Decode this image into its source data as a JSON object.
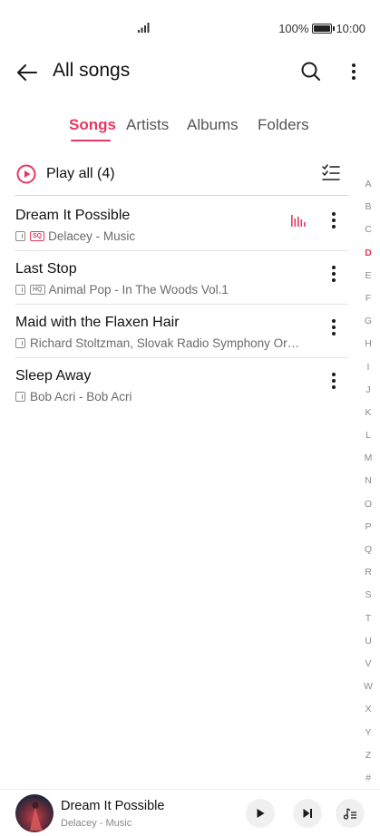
{
  "status_bar": {
    "battery": "100%",
    "time": "10:00",
    "battery_level": 1.0
  },
  "header": {
    "title": "All songs"
  },
  "tabs": [
    {
      "label": "Songs",
      "active": true
    },
    {
      "label": "Artists",
      "active": false
    },
    {
      "label": "Albums",
      "active": false
    },
    {
      "label": "Folders",
      "active": false
    }
  ],
  "play_all": {
    "label": "Play all (4)"
  },
  "songs": [
    {
      "title": "Dream It Possible",
      "subtitle": "Delacey - Music",
      "badge": "SQ",
      "playing": true
    },
    {
      "title": "Last Stop",
      "subtitle": "Animal Pop - In The Woods Vol.1",
      "badge": "HQ",
      "playing": false
    },
    {
      "title": "Maid with the Flaxen Hair",
      "subtitle": "Richard Stoltzman, Slovak Radio Symphony Orc…",
      "badge": "",
      "playing": false
    },
    {
      "title": "Sleep Away",
      "subtitle": "Bob Acri - Bob Acri",
      "badge": "",
      "playing": false
    }
  ],
  "alphabet_index": [
    "A",
    "B",
    "C",
    "D",
    "E",
    "F",
    "G",
    "H",
    "I",
    "J",
    "K",
    "L",
    "M",
    "N",
    "O",
    "P",
    "Q",
    "R",
    "S",
    "T",
    "U",
    "V",
    "W",
    "X",
    "Y",
    "Z",
    "#"
  ],
  "alphabet_active": "D",
  "now_playing": {
    "title": "Dream It Possible",
    "subtitle": "Delacey - Music"
  },
  "colors": {
    "accent": "#e8375f",
    "text": "#111111",
    "secondary_text": "#6b6b6b"
  },
  "icons": {
    "back": "back-arrow-icon",
    "search": "search-icon",
    "more": "more-vertical-icon",
    "play_all": "play-circle-icon",
    "multi_select": "checklist-icon",
    "playing": "equalizer-icon",
    "play": "play-icon",
    "next": "skip-next-icon",
    "queue": "playlist-icon"
  }
}
